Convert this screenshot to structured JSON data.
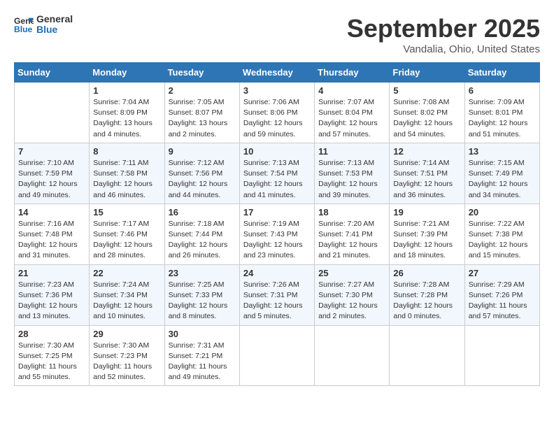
{
  "logo": {
    "line1": "General",
    "line2": "Blue"
  },
  "header": {
    "title": "September 2025",
    "subtitle": "Vandalia, Ohio, United States"
  },
  "weekdays": [
    "Sunday",
    "Monday",
    "Tuesday",
    "Wednesday",
    "Thursday",
    "Friday",
    "Saturday"
  ],
  "weeks": [
    [
      {
        "day": "",
        "info": ""
      },
      {
        "day": "1",
        "info": "Sunrise: 7:04 AM\nSunset: 8:09 PM\nDaylight: 13 hours\nand 4 minutes."
      },
      {
        "day": "2",
        "info": "Sunrise: 7:05 AM\nSunset: 8:07 PM\nDaylight: 13 hours\nand 2 minutes."
      },
      {
        "day": "3",
        "info": "Sunrise: 7:06 AM\nSunset: 8:06 PM\nDaylight: 12 hours\nand 59 minutes."
      },
      {
        "day": "4",
        "info": "Sunrise: 7:07 AM\nSunset: 8:04 PM\nDaylight: 12 hours\nand 57 minutes."
      },
      {
        "day": "5",
        "info": "Sunrise: 7:08 AM\nSunset: 8:02 PM\nDaylight: 12 hours\nand 54 minutes."
      },
      {
        "day": "6",
        "info": "Sunrise: 7:09 AM\nSunset: 8:01 PM\nDaylight: 12 hours\nand 51 minutes."
      }
    ],
    [
      {
        "day": "7",
        "info": "Sunrise: 7:10 AM\nSunset: 7:59 PM\nDaylight: 12 hours\nand 49 minutes."
      },
      {
        "day": "8",
        "info": "Sunrise: 7:11 AM\nSunset: 7:58 PM\nDaylight: 12 hours\nand 46 minutes."
      },
      {
        "day": "9",
        "info": "Sunrise: 7:12 AM\nSunset: 7:56 PM\nDaylight: 12 hours\nand 44 minutes."
      },
      {
        "day": "10",
        "info": "Sunrise: 7:13 AM\nSunset: 7:54 PM\nDaylight: 12 hours\nand 41 minutes."
      },
      {
        "day": "11",
        "info": "Sunrise: 7:13 AM\nSunset: 7:53 PM\nDaylight: 12 hours\nand 39 minutes."
      },
      {
        "day": "12",
        "info": "Sunrise: 7:14 AM\nSunset: 7:51 PM\nDaylight: 12 hours\nand 36 minutes."
      },
      {
        "day": "13",
        "info": "Sunrise: 7:15 AM\nSunset: 7:49 PM\nDaylight: 12 hours\nand 34 minutes."
      }
    ],
    [
      {
        "day": "14",
        "info": "Sunrise: 7:16 AM\nSunset: 7:48 PM\nDaylight: 12 hours\nand 31 minutes."
      },
      {
        "day": "15",
        "info": "Sunrise: 7:17 AM\nSunset: 7:46 PM\nDaylight: 12 hours\nand 28 minutes."
      },
      {
        "day": "16",
        "info": "Sunrise: 7:18 AM\nSunset: 7:44 PM\nDaylight: 12 hours\nand 26 minutes."
      },
      {
        "day": "17",
        "info": "Sunrise: 7:19 AM\nSunset: 7:43 PM\nDaylight: 12 hours\nand 23 minutes."
      },
      {
        "day": "18",
        "info": "Sunrise: 7:20 AM\nSunset: 7:41 PM\nDaylight: 12 hours\nand 21 minutes."
      },
      {
        "day": "19",
        "info": "Sunrise: 7:21 AM\nSunset: 7:39 PM\nDaylight: 12 hours\nand 18 minutes."
      },
      {
        "day": "20",
        "info": "Sunrise: 7:22 AM\nSunset: 7:38 PM\nDaylight: 12 hours\nand 15 minutes."
      }
    ],
    [
      {
        "day": "21",
        "info": "Sunrise: 7:23 AM\nSunset: 7:36 PM\nDaylight: 12 hours\nand 13 minutes."
      },
      {
        "day": "22",
        "info": "Sunrise: 7:24 AM\nSunset: 7:34 PM\nDaylight: 12 hours\nand 10 minutes."
      },
      {
        "day": "23",
        "info": "Sunrise: 7:25 AM\nSunset: 7:33 PM\nDaylight: 12 hours\nand 8 minutes."
      },
      {
        "day": "24",
        "info": "Sunrise: 7:26 AM\nSunset: 7:31 PM\nDaylight: 12 hours\nand 5 minutes."
      },
      {
        "day": "25",
        "info": "Sunrise: 7:27 AM\nSunset: 7:30 PM\nDaylight: 12 hours\nand 2 minutes."
      },
      {
        "day": "26",
        "info": "Sunrise: 7:28 AM\nSunset: 7:28 PM\nDaylight: 12 hours\nand 0 minutes."
      },
      {
        "day": "27",
        "info": "Sunrise: 7:29 AM\nSunset: 7:26 PM\nDaylight: 11 hours\nand 57 minutes."
      }
    ],
    [
      {
        "day": "28",
        "info": "Sunrise: 7:30 AM\nSunset: 7:25 PM\nDaylight: 11 hours\nand 55 minutes."
      },
      {
        "day": "29",
        "info": "Sunrise: 7:30 AM\nSunset: 7:23 PM\nDaylight: 11 hours\nand 52 minutes."
      },
      {
        "day": "30",
        "info": "Sunrise: 7:31 AM\nSunset: 7:21 PM\nDaylight: 11 hours\nand 49 minutes."
      },
      {
        "day": "",
        "info": ""
      },
      {
        "day": "",
        "info": ""
      },
      {
        "day": "",
        "info": ""
      },
      {
        "day": "",
        "info": ""
      }
    ]
  ]
}
